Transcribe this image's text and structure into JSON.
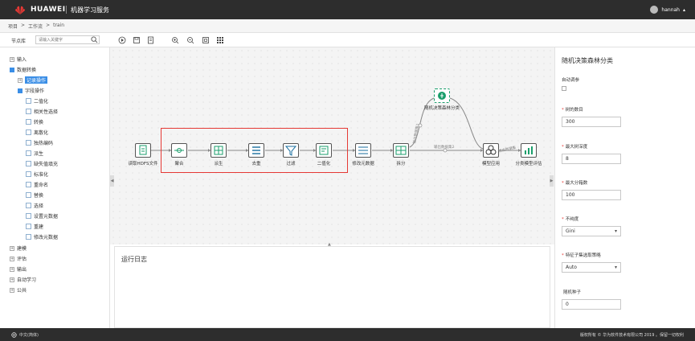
{
  "header": {
    "brand": "HUAWEI",
    "service": "机器学习服务",
    "user": "hannah",
    "user_caret": "▴"
  },
  "breadcrumb": {
    "items": [
      "项目",
      "工作流",
      "train"
    ],
    "separator": ">"
  },
  "library": {
    "title": "节点库",
    "search_placeholder": "请输入关键字"
  },
  "sidebar": {
    "groups": [
      {
        "label": "输入",
        "toggle": "+"
      },
      {
        "label": "数据转换",
        "toggle": "-"
      },
      {
        "label": "记录操作",
        "toggle": "+"
      },
      {
        "label": "字段操作",
        "toggle": "-"
      },
      {
        "label": "建模",
        "toggle": "+"
      },
      {
        "label": "评估",
        "toggle": "+"
      },
      {
        "label": "输出",
        "toggle": "+"
      },
      {
        "label": "自动学习",
        "toggle": "+"
      },
      {
        "label": "公共",
        "toggle": "+"
      }
    ],
    "field_ops": [
      "二值化",
      "相关性选择",
      "转换",
      "离散化",
      "独热编码",
      "派生",
      "缺失值填充",
      "标准化",
      "重命名",
      "替换",
      "选择",
      "设置元数据",
      "重建",
      "修改元数据"
    ]
  },
  "flow": {
    "nodes": [
      "读取HDFS文件",
      "聚合",
      "派生",
      "去重",
      "过滤",
      "二值化",
      "修改元数据",
      "拆分",
      "随机决策森林分类",
      "模型应用",
      "分类模型评估"
    ],
    "edge_labels": [
      "输出数据集1",
      "输出数据集2",
      "输出数据集"
    ]
  },
  "log": {
    "title": "运行日志"
  },
  "props": {
    "title": "随机决策森林分类",
    "auto_tune_label": "自动调参",
    "fields": [
      {
        "label": "树的数目",
        "value": "300",
        "required": "*"
      },
      {
        "label": "最大树深度",
        "value": "8",
        "required": "*"
      },
      {
        "label": "最大分箱数",
        "value": "100",
        "required": "*"
      },
      {
        "label": "不纯度",
        "value": "Gini",
        "required": "*"
      },
      {
        "label": "特征子集选取策略",
        "value": "Auto",
        "required": "*"
      },
      {
        "label": "随机种子",
        "value": "0",
        "required": ""
      }
    ]
  },
  "footer": {
    "lang": "中文(简体)",
    "copyright": "版权所有 © 华为软件技术有限公司 2019 。保留一切权利"
  },
  "colors": {
    "header_bg": "#2d2d2d",
    "accent": "#3a8ee6",
    "highlight": "#e53935",
    "node_accent": "#1a9e6b"
  }
}
